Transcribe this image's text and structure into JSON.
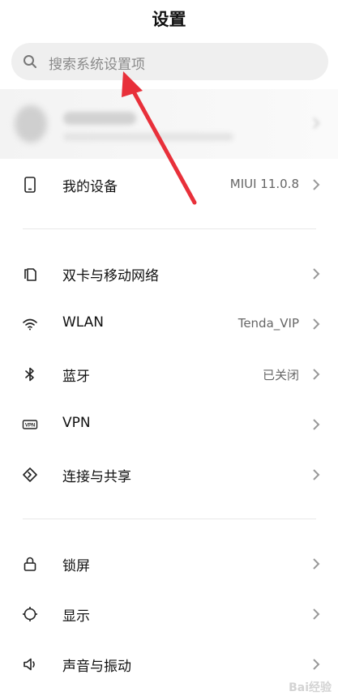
{
  "header": {
    "title": "设置"
  },
  "search": {
    "placeholder": "搜索系统设置项",
    "icon": "search-icon"
  },
  "rows": [
    {
      "label": "我的设备",
      "value": "MIUI 11.0.8",
      "icon": "phone-icon"
    },
    {
      "label": "双卡与移动网络",
      "value": "",
      "icon": "dual-sim-icon"
    },
    {
      "label": "WLAN",
      "value": "Tenda_VIP",
      "icon": "wifi-icon"
    },
    {
      "label": "蓝牙",
      "value": "已关闭",
      "icon": "bluetooth-icon"
    },
    {
      "label": "VPN",
      "value": "",
      "icon": "vpn-icon"
    },
    {
      "label": "连接与共享",
      "value": "",
      "icon": "share-connection-icon"
    },
    {
      "label": "锁屏",
      "value": "",
      "icon": "lock-icon"
    },
    {
      "label": "显示",
      "value": "",
      "icon": "brightness-icon"
    },
    {
      "label": "声音与振动",
      "value": "",
      "icon": "speaker-icon"
    }
  ],
  "watermark": "Bai经验",
  "colors": {
    "arrow": "#e8303a",
    "search_bg": "#efefef",
    "divider": "#e9e9e9"
  }
}
